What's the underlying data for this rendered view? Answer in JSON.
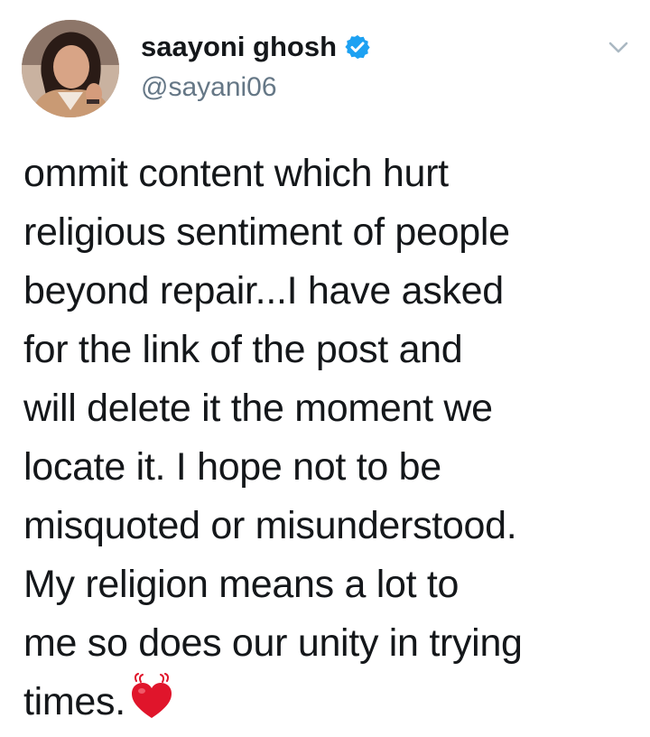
{
  "tweet": {
    "author": {
      "display_name": "saayoni ghosh",
      "handle": "@sayani06",
      "verified_icon": "verified-badge-icon",
      "avatar_icon": "avatar"
    },
    "menu_icon": "chevron-down-icon",
    "text_lines": [
      "ommit content which hurt",
      "religious sentiment of people",
      "beyond repair...I have asked",
      "for the link of the post and",
      "will delete it the moment we",
      "locate it. I hope not to be",
      "misquoted or misunderstood.",
      "My religion means a lot to",
      "me so does our unity in trying",
      "times."
    ],
    "emoji_icon": "beating-heart-icon"
  },
  "colors": {
    "text": "#14171a",
    "secondary": "#657786",
    "verified_blue": "#1da1f2",
    "heart_red": "#e0152b",
    "caret_gray": "#aab8c2"
  }
}
